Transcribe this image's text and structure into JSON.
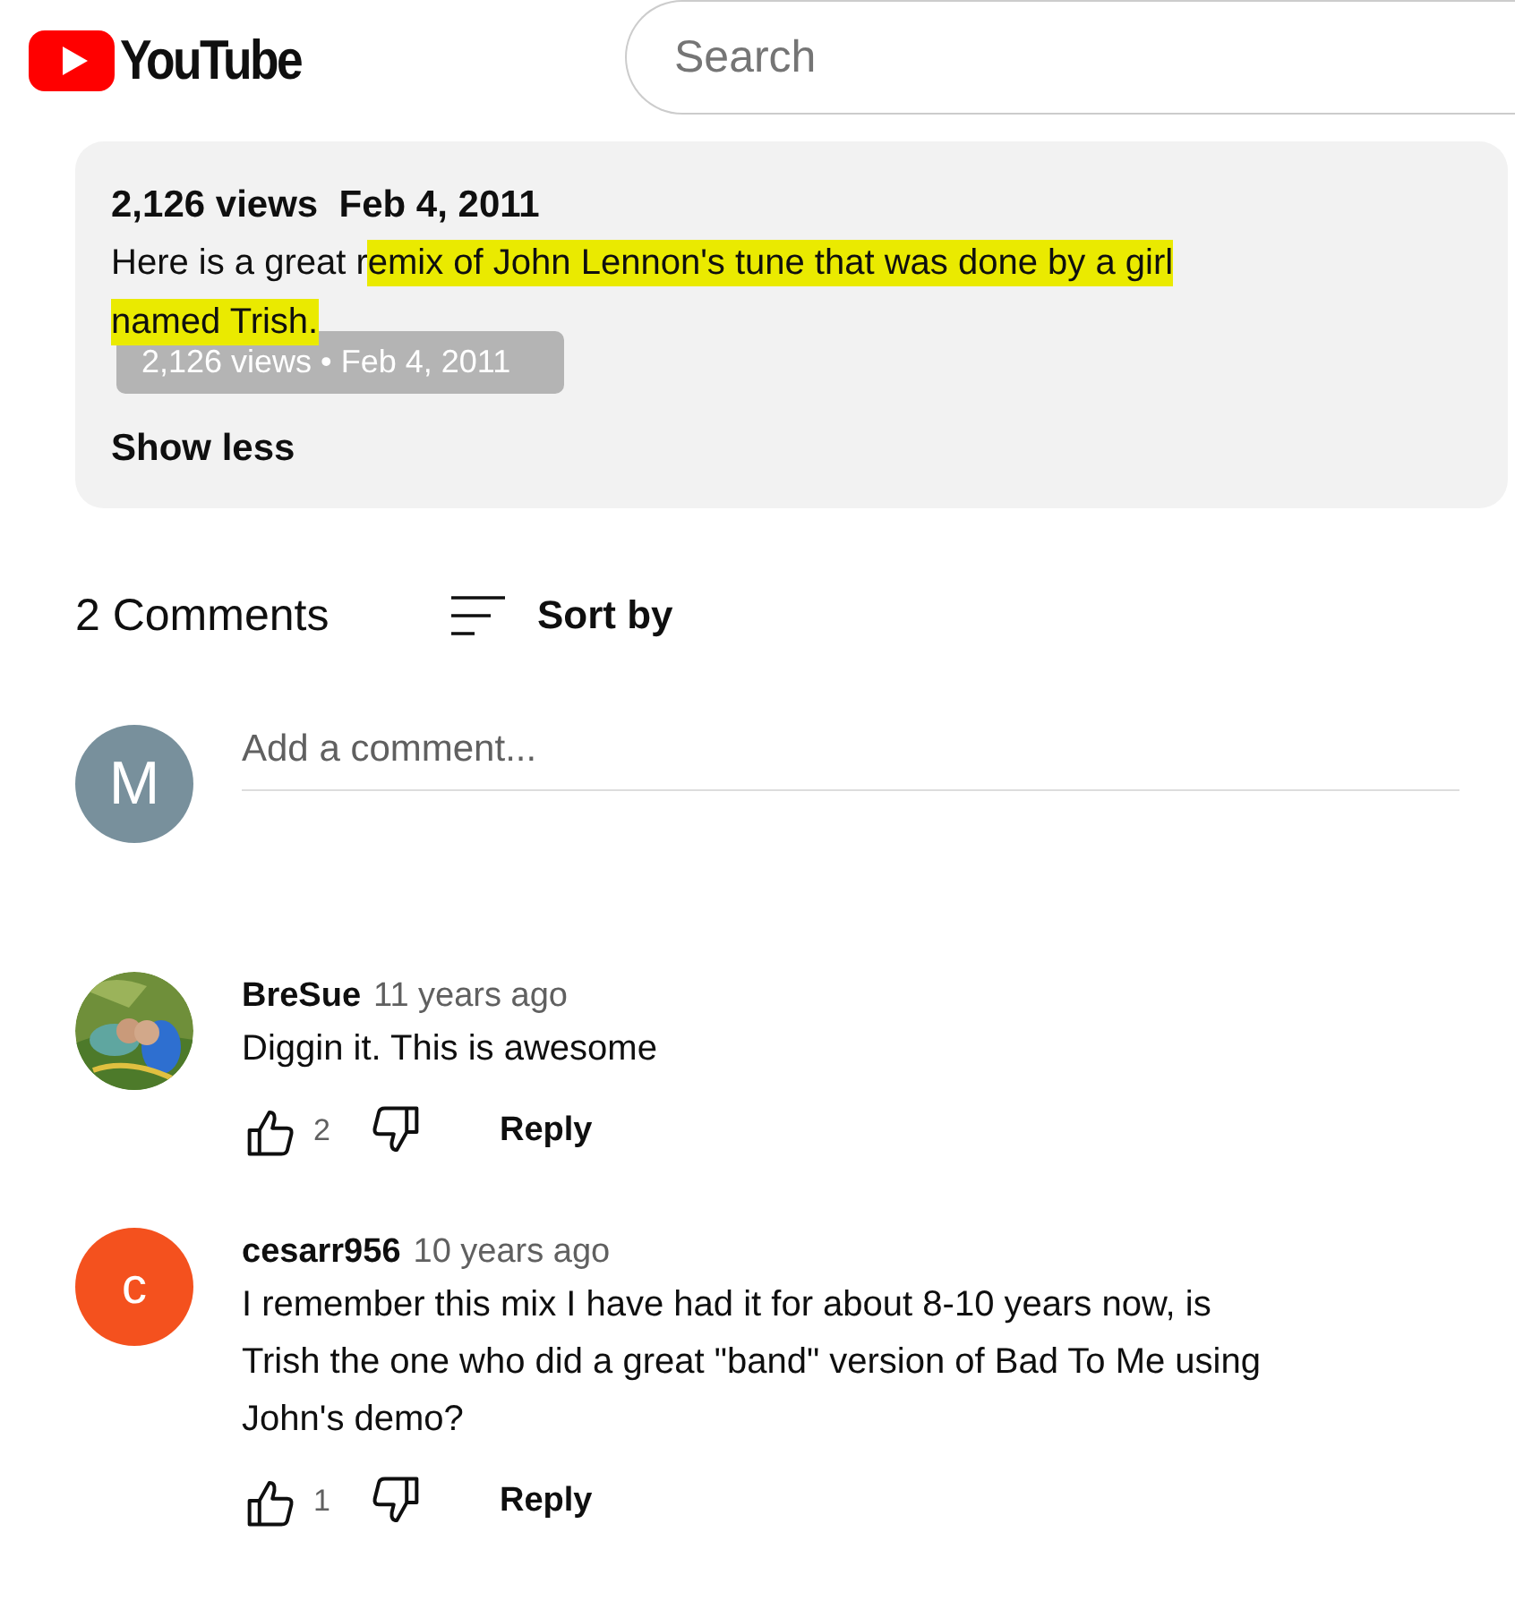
{
  "header": {
    "logo_text": "YouTube",
    "search": {
      "placeholder": "Search"
    }
  },
  "description": {
    "stats": "2,126 views  Feb 4, 2011",
    "segments": [
      {
        "text": "Here is a great r",
        "highlighted": false
      },
      {
        "text": "emix of John Lennon's tune that was done by a girl named Trish.",
        "highlighted": true
      }
    ],
    "tooltip": "2,126 views • Feb 4, 2011",
    "toggle": "Show less"
  },
  "comments_header": {
    "count": "2 Comments",
    "sort": "Sort by"
  },
  "add_comment": {
    "avatar_letter": "M",
    "color": "#78909c",
    "placeholder": "Add a comment..."
  },
  "comments": [
    {
      "author": "BreSue",
      "time": "11 years ago",
      "text": "Diggin it. This is awesome",
      "likes": "2",
      "reply": "Reply"
    },
    {
      "avatar": {
        "kind": "letter",
        "letter": "c",
        "color": "#f4511e"
      },
      "author": "cesarr956",
      "time": "10 years ago",
      "text": "I remember this mix I have had it for about 8-10 years now, is Trish the one who did a great \"band\" version of Bad To Me using John's demo?",
      "likes": "1",
      "reply": "Reply"
    }
  ]
}
